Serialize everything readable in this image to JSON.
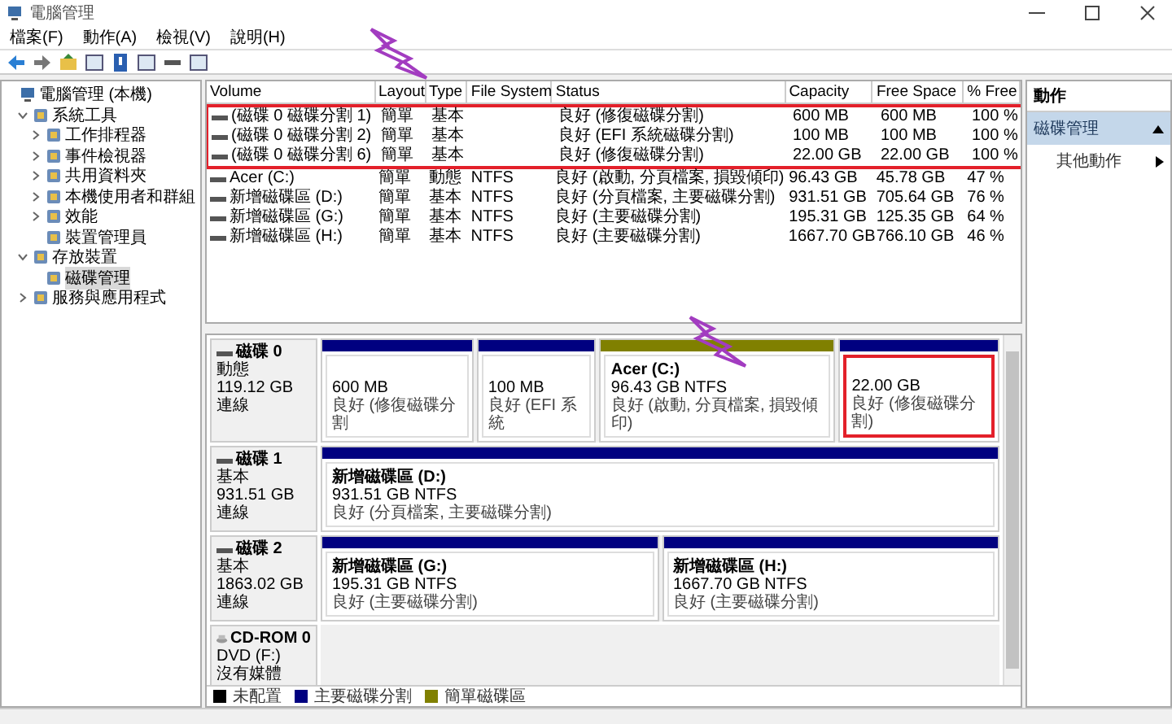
{
  "window": {
    "title": "電腦管理"
  },
  "menu": [
    "檔案(F)",
    "動作(A)",
    "檢視(V)",
    "說明(H)"
  ],
  "tree": [
    {
      "label": "電腦管理 (本機)",
      "selected": false,
      "children": [
        {
          "label": "系統工具",
          "expanded": true,
          "selected": false,
          "children": [
            {
              "label": "工作排程器",
              "expanded": false,
              "selected": false
            },
            {
              "label": "事件檢視器",
              "expanded": false,
              "selected": false
            },
            {
              "label": "共用資料夾",
              "expanded": false,
              "selected": false
            },
            {
              "label": "本機使用者和群組",
              "expanded": false,
              "selected": false
            },
            {
              "label": "效能",
              "expanded": false,
              "selected": false
            },
            {
              "label": "裝置管理員",
              "selected": false
            }
          ]
        },
        {
          "label": "存放裝置",
          "expanded": true,
          "selected": false,
          "children": [
            {
              "label": "磁碟管理",
              "selected": true
            }
          ]
        },
        {
          "label": "服務與應用程式",
          "expanded": false,
          "selected": false
        }
      ]
    }
  ],
  "volumes": {
    "columns": [
      "Volume",
      "Layout",
      "Type",
      "File System",
      "Status",
      "Capacity",
      "Free Space",
      "% Free"
    ],
    "rows": [
      {
        "cells": [
          "(磁碟 0 磁碟分割 1)",
          "簡單",
          "基本",
          "",
          "良好 (修復磁碟分割)",
          "600 MB",
          "600 MB",
          "100 %"
        ],
        "highlighted": true
      },
      {
        "cells": [
          "(磁碟 0 磁碟分割 2)",
          "簡單",
          "基本",
          "",
          "良好 (EFI 系統磁碟分割)",
          "100 MB",
          "100 MB",
          "100 %"
        ],
        "highlighted": true
      },
      {
        "cells": [
          "(磁碟 0 磁碟分割 6)",
          "簡單",
          "基本",
          "",
          "良好 (修復磁碟分割)",
          "22.00 GB",
          "22.00 GB",
          "100 %"
        ],
        "highlighted": true
      },
      {
        "cells": [
          "Acer (C:)",
          "簡單",
          "動態",
          "NTFS",
          "良好 (啟動, 分頁檔案, 損毀傾印)",
          "96.43 GB",
          "45.78 GB",
          "47 %"
        ],
        "highlighted": false
      },
      {
        "cells": [
          "新增磁碟區 (D:)",
          "簡單",
          "基本",
          "NTFS",
          "良好 (分頁檔案, 主要磁碟分割)",
          "931.51 GB",
          "705.64 GB",
          "76 %"
        ],
        "highlighted": false
      },
      {
        "cells": [
          "新增磁碟區 (G:)",
          "簡單",
          "基本",
          "NTFS",
          "良好 (主要磁碟分割)",
          "195.31 GB",
          "125.35 GB",
          "64 %"
        ],
        "highlighted": false
      },
      {
        "cells": [
          "新增磁碟區 (H:)",
          "簡單",
          "基本",
          "NTFS",
          "良好 (主要磁碟分割)",
          "1667.70 GB",
          "766.10 GB",
          "46 %"
        ],
        "highlighted": false
      }
    ]
  },
  "disks": [
    {
      "kind": "disk",
      "name": "磁碟 0",
      "lines": [
        "動態",
        "119.12 GB",
        "連線"
      ],
      "partitions": [
        {
          "size": "600 MB",
          "status": "良好 (修復磁碟分割",
          "color": "#000080",
          "highlighted": false
        },
        {
          "size": "100 MB",
          "status": "良好 (EFI 系統",
          "color": "#000080",
          "highlighted": false
        },
        {
          "name": "Acer (C:)",
          "size": "96.43 GB NTFS",
          "status": "良好 (啟動, 分頁檔案, 損毀傾印)",
          "color": "#808000",
          "highlighted": false
        },
        {
          "size": "22.00 GB",
          "status": "良好 (修復磁碟分割)",
          "color": "#000080",
          "highlighted": true
        }
      ]
    },
    {
      "kind": "disk",
      "name": "磁碟 1",
      "lines": [
        "基本",
        "931.51 GB",
        "連線"
      ],
      "partitions": [
        {
          "name": "新增磁碟區 (D:)",
          "size": "931.51 GB NTFS",
          "status": "良好 (分頁檔案, 主要磁碟分割)",
          "color": "#000080",
          "highlighted": false
        }
      ]
    },
    {
      "kind": "disk",
      "name": "磁碟 2",
      "lines": [
        "基本",
        "1863.02 GB",
        "連線"
      ],
      "partitions": [
        {
          "name": "新增磁碟區 (G:)",
          "size": "195.31 GB NTFS",
          "status": "良好 (主要磁碟分割)",
          "color": "#000080",
          "highlighted": false
        },
        {
          "name": "新增磁碟區 (H:)",
          "size": "1667.70 GB NTFS",
          "status": "良好 (主要磁碟分割)",
          "color": "#000080",
          "highlighted": false
        }
      ]
    },
    {
      "kind": "cdrom",
      "name": "CD-ROM 0",
      "lines": [
        "DVD (F:)",
        "沒有媒體"
      ]
    }
  ],
  "legend": [
    {
      "label": "未配置",
      "color": "#000000"
    },
    {
      "label": "主要磁碟分割",
      "color": "#000080"
    },
    {
      "label": "簡單磁碟區",
      "color": "#808000"
    }
  ],
  "actions": {
    "header": "動作",
    "section": "磁碟管理",
    "items": [
      "其他動作"
    ]
  }
}
